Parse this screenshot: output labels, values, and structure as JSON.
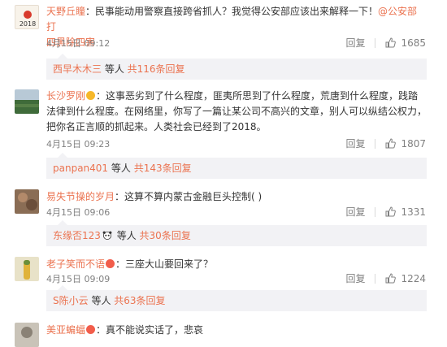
{
  "comments": [
    {
      "username": "天野丘瞳",
      "text_line1": "：民事能动用警察直接跨省抓人？我觉得公安部应该出来解释一下！",
      "mention_line1": "@公安部打",
      "mention_line2": "四黑除四害",
      "time": "4月15日 09:12",
      "reply_label": "回复",
      "likes": "1685",
      "avatar_text": "2018",
      "replies": {
        "user": "西早木木三",
        "mid": " 等人 ",
        "count": "共116条回复"
      }
    },
    {
      "username": "长沙罗刚",
      "badge": "v",
      "line1": "：这事恶劣到了什么程度，匪夷所思到了什么程度，荒唐到什么程度，践踏",
      "line2": "法律到什么程度。在网络里，你写了一篇让某公司不高兴的文章，别人可以纵结公权力，",
      "line3": "把你名正言顺的抓起来。人类社会已经到了2018。",
      "time": "4月15日 09:23",
      "reply_label": "回复",
      "likes": "1807",
      "replies": {
        "user": "panpan401",
        "mid": " 等人 ",
        "count": "共143条回复"
      }
    },
    {
      "username": "易失节操的岁月",
      "text": "：这算不算内蒙古金融巨头控制(  )",
      "time": "4月15日 09:06",
      "reply_label": "回复",
      "likes": "1331",
      "replies": {
        "user": "东缘否123",
        "mid": " 等人 ",
        "count": "共30条回复"
      }
    },
    {
      "username": "老子笑而不语",
      "badge": "vip",
      "text": "：三座大山要回来了？",
      "time": "4月15日 09:09",
      "reply_label": "回复",
      "likes": "1224",
      "replies": {
        "user": "S陈小云",
        "mid": " 等人 ",
        "count": "共63条回复"
      }
    },
    {
      "username": "美亚蝙蝠",
      "badge": "vip",
      "text": "：真不能说实话了，悲哀"
    }
  ],
  "colors": {
    "username": "#eb7350",
    "text": "#333333",
    "meta": "#808080",
    "reply_bg": "#f2f2f5"
  }
}
